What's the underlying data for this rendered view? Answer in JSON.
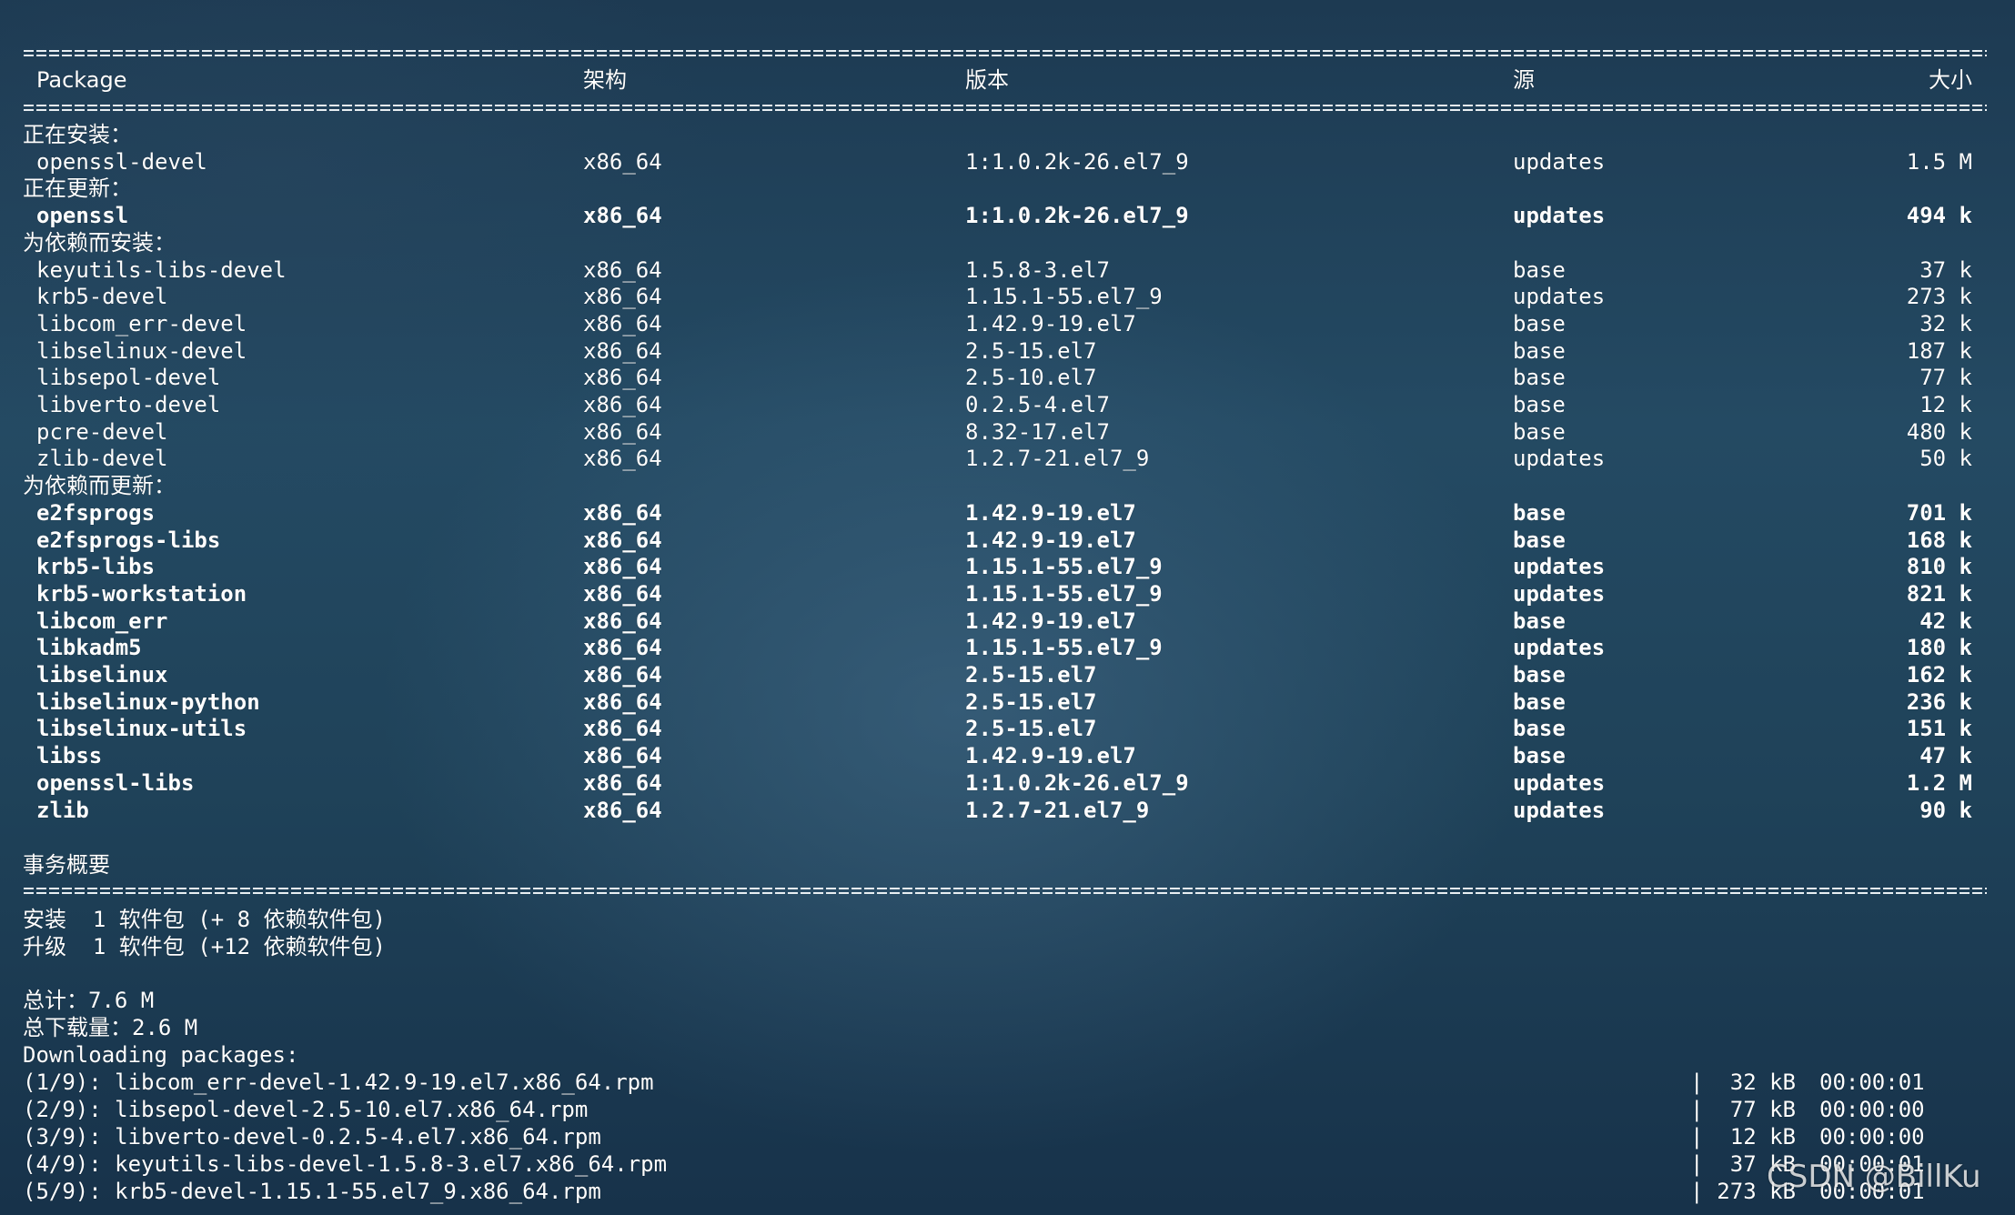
{
  "header": {
    "package": "Package",
    "arch": "架构",
    "version": "版本",
    "repo": "源",
    "size": "大小"
  },
  "sections": [
    {
      "title": "正在安装：",
      "bold": false,
      "rows": [
        {
          "name": "openssl-devel",
          "arch": "x86_64",
          "version": "1:1.0.2k-26.el7_9",
          "repo": "updates",
          "size": "1.5 M"
        }
      ]
    },
    {
      "title": "正在更新：",
      "bold": true,
      "rows": [
        {
          "name": "openssl",
          "arch": "x86_64",
          "version": "1:1.0.2k-26.el7_9",
          "repo": "updates",
          "size": "494 k"
        }
      ]
    },
    {
      "title": "为依赖而安装：",
      "bold": false,
      "rows": [
        {
          "name": "keyutils-libs-devel",
          "arch": "x86_64",
          "version": "1.5.8-3.el7",
          "repo": "base",
          "size": "37 k"
        },
        {
          "name": "krb5-devel",
          "arch": "x86_64",
          "version": "1.15.1-55.el7_9",
          "repo": "updates",
          "size": "273 k"
        },
        {
          "name": "libcom_err-devel",
          "arch": "x86_64",
          "version": "1.42.9-19.el7",
          "repo": "base",
          "size": "32 k"
        },
        {
          "name": "libselinux-devel",
          "arch": "x86_64",
          "version": "2.5-15.el7",
          "repo": "base",
          "size": "187 k"
        },
        {
          "name": "libsepol-devel",
          "arch": "x86_64",
          "version": "2.5-10.el7",
          "repo": "base",
          "size": "77 k"
        },
        {
          "name": "libverto-devel",
          "arch": "x86_64",
          "version": "0.2.5-4.el7",
          "repo": "base",
          "size": "12 k"
        },
        {
          "name": "pcre-devel",
          "arch": "x86_64",
          "version": "8.32-17.el7",
          "repo": "base",
          "size": "480 k"
        },
        {
          "name": "zlib-devel",
          "arch": "x86_64",
          "version": "1.2.7-21.el7_9",
          "repo": "updates",
          "size": "50 k"
        }
      ]
    },
    {
      "title": "为依赖而更新：",
      "bold": true,
      "rows": [
        {
          "name": "e2fsprogs",
          "arch": "x86_64",
          "version": "1.42.9-19.el7",
          "repo": "base",
          "size": "701 k"
        },
        {
          "name": "e2fsprogs-libs",
          "arch": "x86_64",
          "version": "1.42.9-19.el7",
          "repo": "base",
          "size": "168 k"
        },
        {
          "name": "krb5-libs",
          "arch": "x86_64",
          "version": "1.15.1-55.el7_9",
          "repo": "updates",
          "size": "810 k"
        },
        {
          "name": "krb5-workstation",
          "arch": "x86_64",
          "version": "1.15.1-55.el7_9",
          "repo": "updates",
          "size": "821 k"
        },
        {
          "name": "libcom_err",
          "arch": "x86_64",
          "version": "1.42.9-19.el7",
          "repo": "base",
          "size": "42 k"
        },
        {
          "name": "libkadm5",
          "arch": "x86_64",
          "version": "1.15.1-55.el7_9",
          "repo": "updates",
          "size": "180 k"
        },
        {
          "name": "libselinux",
          "arch": "x86_64",
          "version": "2.5-15.el7",
          "repo": "base",
          "size": "162 k"
        },
        {
          "name": "libselinux-python",
          "arch": "x86_64",
          "version": "2.5-15.el7",
          "repo": "base",
          "size": "236 k"
        },
        {
          "name": "libselinux-utils",
          "arch": "x86_64",
          "version": "2.5-15.el7",
          "repo": "base",
          "size": "151 k"
        },
        {
          "name": "libss",
          "arch": "x86_64",
          "version": "1.42.9-19.el7",
          "repo": "base",
          "size": "47 k"
        },
        {
          "name": "openssl-libs",
          "arch": "x86_64",
          "version": "1:1.0.2k-26.el7_9",
          "repo": "updates",
          "size": "1.2 M"
        },
        {
          "name": "zlib",
          "arch": "x86_64",
          "version": "1.2.7-21.el7_9",
          "repo": "updates",
          "size": "90 k"
        }
      ]
    }
  ],
  "summary": {
    "title": "事务概要",
    "install": "安装  1 软件包 (+ 8 依赖软件包)",
    "upgrade": "升级  1 软件包 (+12 依赖软件包)",
    "total": "总计：7.6 M",
    "total_download": "总下载量：2.6 M",
    "downloading": "Downloading packages:"
  },
  "downloads": [
    {
      "file": "(1/9): libcom_err-devel-1.42.9-19.el7.x86_64.rpm",
      "size": "32 kB",
      "time": "00:00:01"
    },
    {
      "file": "(2/9): libsepol-devel-2.5-10.el7.x86_64.rpm",
      "size": "77 kB",
      "time": "00:00:00"
    },
    {
      "file": "(3/9): libverto-devel-0.2.5-4.el7.x86_64.rpm",
      "size": "12 kB",
      "time": "00:00:00"
    },
    {
      "file": "(4/9): keyutils-libs-devel-1.5.8-3.el7.x86_64.rpm",
      "size": "37 kB",
      "time": "00:00:01"
    },
    {
      "file": "(5/9): krb5-devel-1.15.1-55.el7_9.x86_64.rpm",
      "size": "273 kB",
      "time": "00:00:01"
    }
  ],
  "watermark": "CSDN @BillKu"
}
